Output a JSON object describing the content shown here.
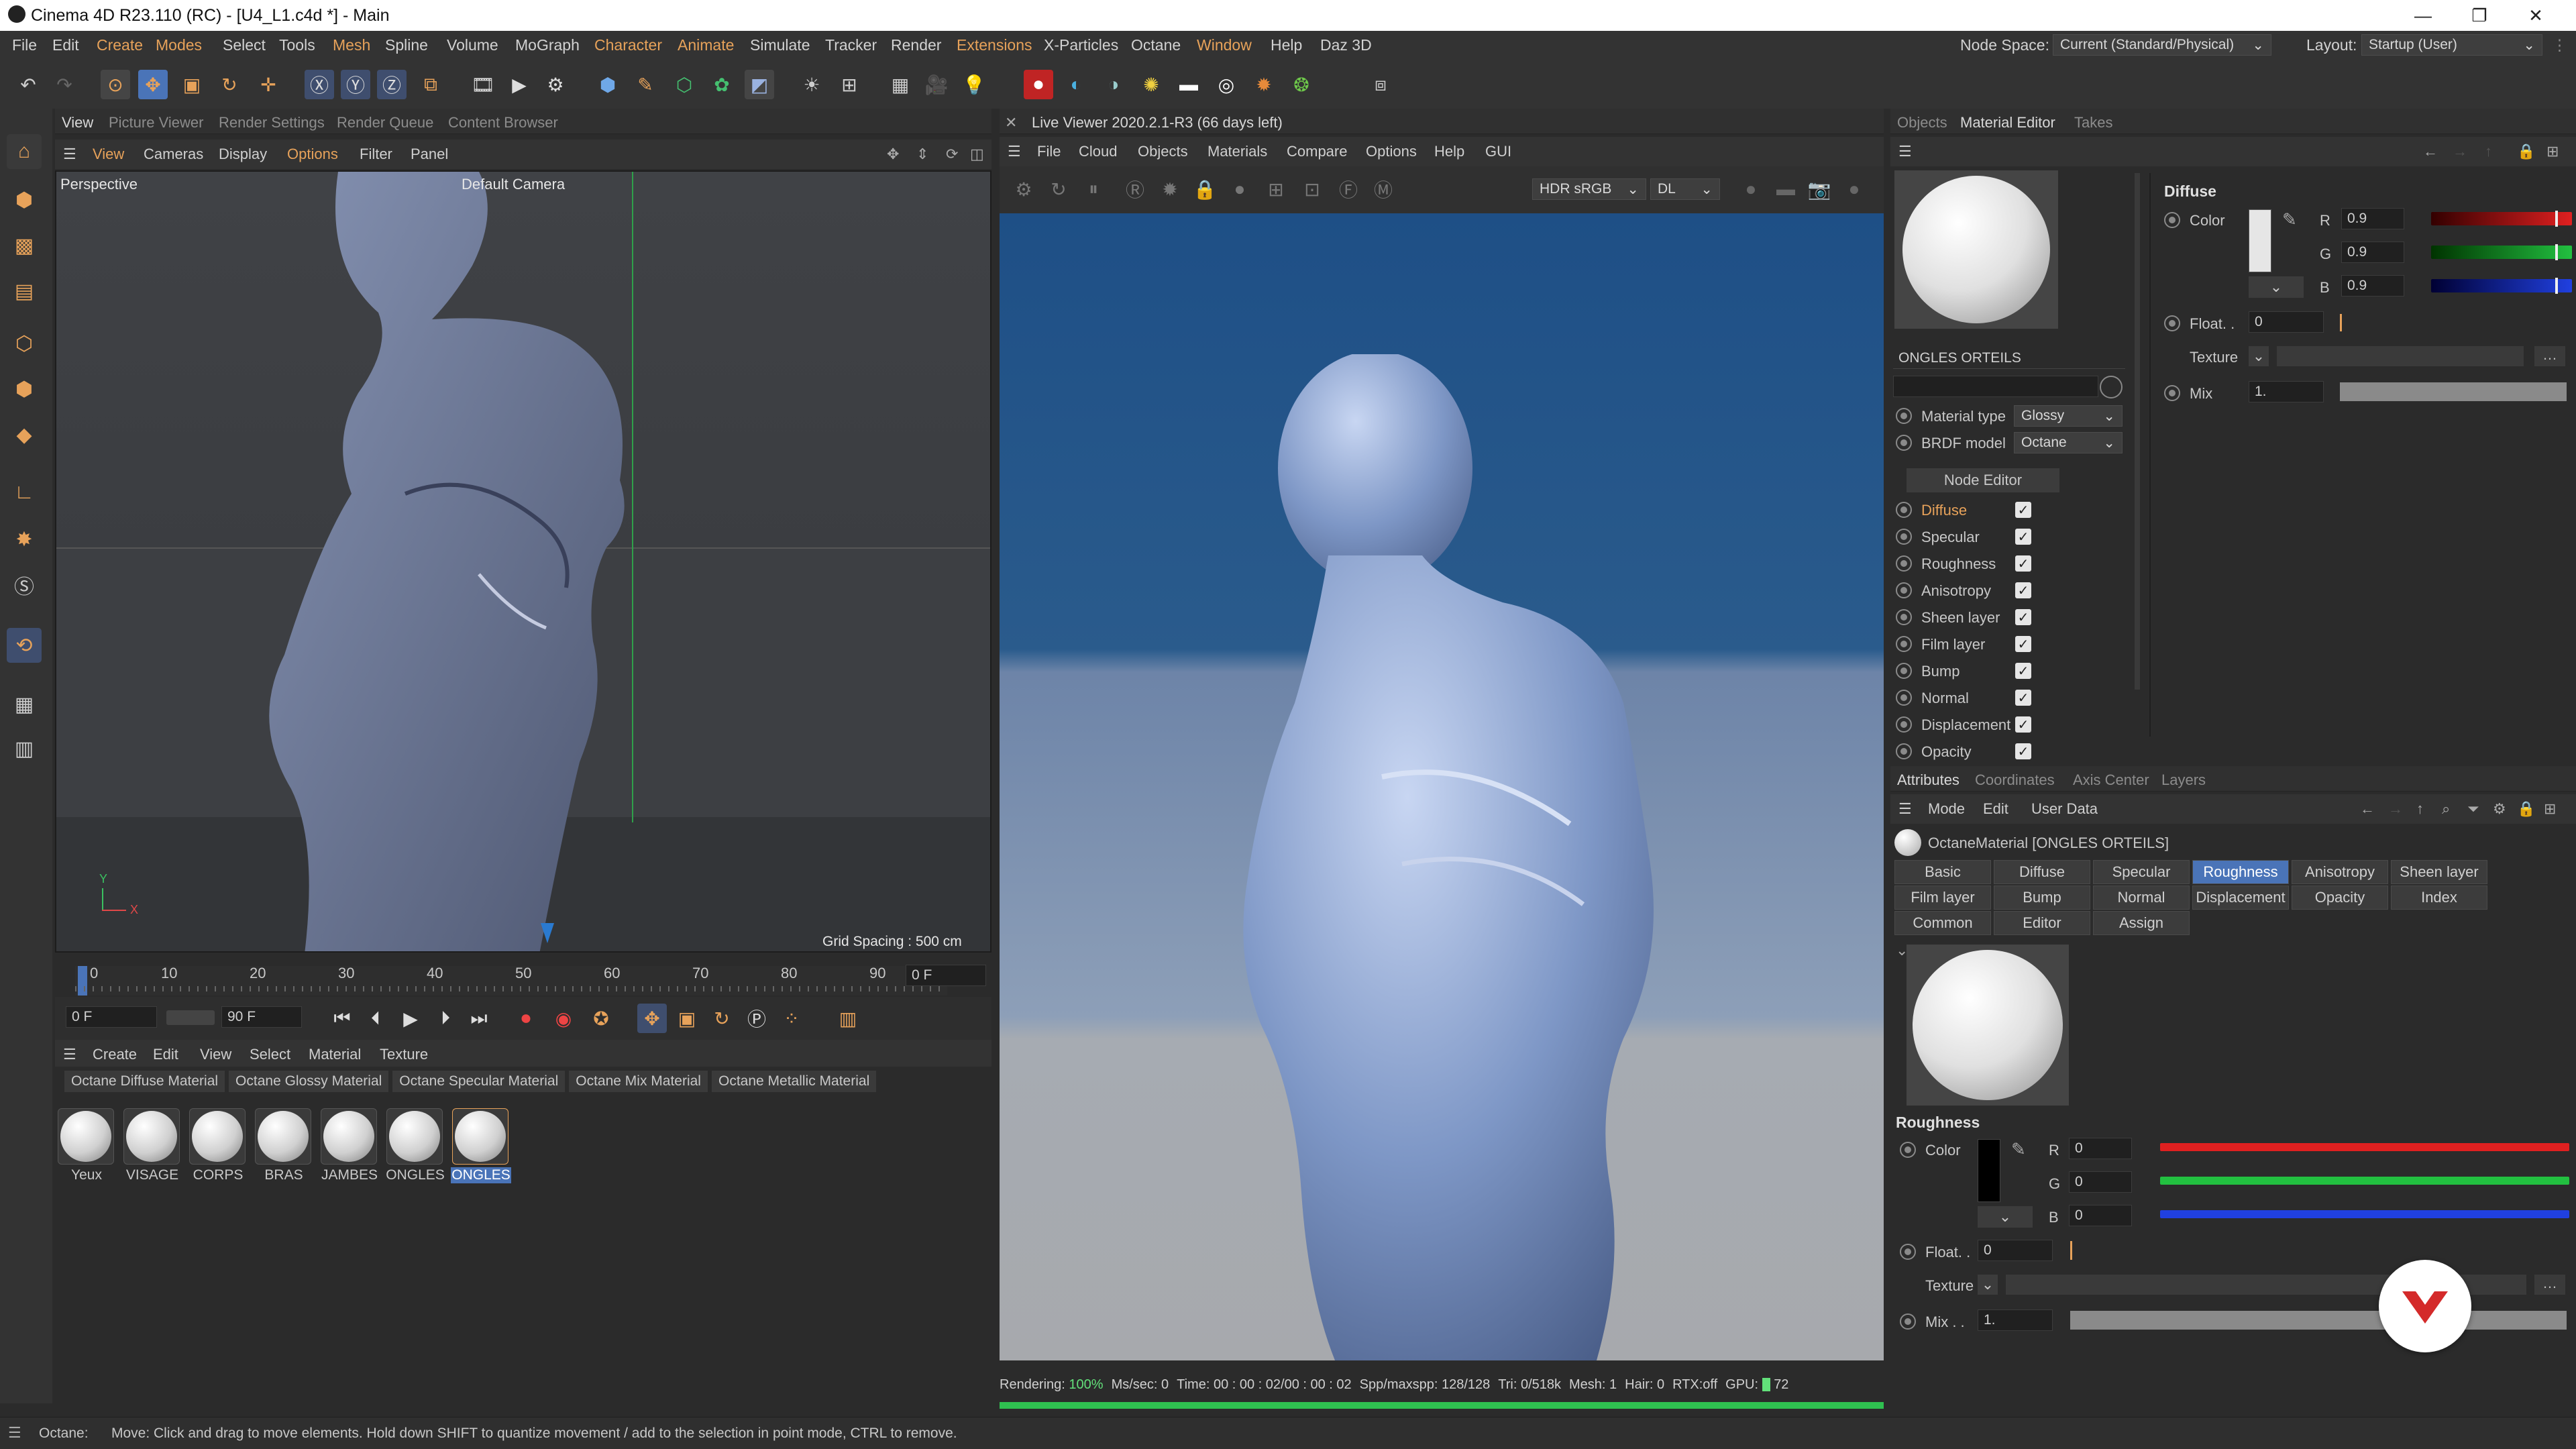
{
  "window": {
    "title": "Cinema 4D R23.110 (RC) - [U4_L1.c4d *] - Main"
  },
  "menubar": {
    "items": [
      "File",
      "Edit",
      "Create",
      "Modes",
      "Select",
      "Tools",
      "Mesh",
      "Spline",
      "Volume",
      "MoGraph",
      "Character",
      "Animate",
      "Simulate",
      "Tracker",
      "Render",
      "Extensions",
      "X-Particles",
      "Octane",
      "Window",
      "Help",
      "Daz 3D"
    ],
    "node_space_label": "Node Space:",
    "node_space_value": "Current (Standard/Physical)",
    "layout_label": "Layout:",
    "layout_value": "Startup (User)"
  },
  "viewport_panel": {
    "tabs": [
      "View",
      "Picture Viewer",
      "Render Settings",
      "Render Queue",
      "Content Browser"
    ],
    "menu": [
      "View",
      "Cameras",
      "Display",
      "Options",
      "Filter",
      "Panel"
    ],
    "label": "Perspective",
    "camera": "Default Camera",
    "grid_spacing": "Grid Spacing : 500 cm",
    "axis_y": "Y",
    "axis_x": "X"
  },
  "timeline": {
    "ticks": [
      "0",
      "10",
      "20",
      "30",
      "40",
      "50",
      "60",
      "70",
      "80",
      "90"
    ],
    "current_frame": "0 F",
    "start_field": "0 F",
    "end_field": "90 F"
  },
  "material_manager": {
    "menu": [
      "Create",
      "Edit",
      "View",
      "Select",
      "Material",
      "Texture"
    ],
    "presets": [
      "Octane Diffuse Material",
      "Octane Glossy Material",
      "Octane Specular Material",
      "Octane Mix Material",
      "Octane Metallic Material"
    ],
    "materials": [
      "Yeux",
      "VISAGE",
      "CORPS",
      "BRAS",
      "JAMBES",
      "ONGLES",
      "ONGLES"
    ]
  },
  "live_viewer": {
    "title": "Live Viewer 2020.2.1-R3 (66 days left)",
    "menu": [
      "File",
      "Cloud",
      "Objects",
      "Materials",
      "Compare",
      "Options",
      "Help",
      "GUI"
    ],
    "color_space": "HDR sRGB",
    "kernel": "DL",
    "status": {
      "rendering": "Rendering:",
      "rendering_pct": "100%",
      "mssec": "Ms/sec: 0",
      "time": "Time: 00 : 00 : 02/00 : 00 : 02",
      "spp": "Spp/maxspp: 128/128",
      "tri": "Tri: 0/518k",
      "mesh": "Mesh: 1",
      "hair": "Hair: 0",
      "rtx": "RTX:off",
      "gpu": "GPU:",
      "gpu_val": "72"
    },
    "progress": 1.0
  },
  "material_editor": {
    "tabs": [
      "Objects",
      "Material Editor",
      "Takes"
    ],
    "material_name": "ONGLES ORTEILS",
    "material_type_label": "Material type",
    "material_type": "Glossy",
    "brdf_label": "BRDF model",
    "brdf": "Octane",
    "node_editor": "Node Editor",
    "channels": [
      "Diffuse",
      "Specular",
      "Roughness",
      "Anisotropy",
      "Sheen layer",
      "Film layer",
      "Bump",
      "Normal",
      "Displacement",
      "Opacity"
    ],
    "diffuse": {
      "heading": "Diffuse",
      "color_label": "Color",
      "r_label": "R",
      "r": "0.9",
      "g_label": "G",
      "g": "0.9",
      "b_label": "B",
      "b": "0.9",
      "float_label": "Float. .",
      "float": "0",
      "texture_label": "Texture",
      "mix_label": "Mix",
      "mix": "1.",
      "color_hex": "#e6e6e6",
      "rgb_fraction": 0.9
    }
  },
  "attributes": {
    "tabs": [
      "Attributes",
      "Coordinates",
      "Axis Center",
      "Layers"
    ],
    "menu": [
      "Mode",
      "Edit",
      "User Data"
    ],
    "object_label": "OctaneMaterial [ONGLES ORTEILS]",
    "param_tabs": [
      "Basic",
      "Diffuse",
      "Specular",
      "Roughness",
      "Anisotropy",
      "Sheen layer",
      "Film layer",
      "Bump",
      "Normal",
      "Displacement",
      "Opacity",
      "Index",
      "Common",
      "Editor",
      "Assign"
    ],
    "active_tab": "Roughness",
    "roughness": {
      "heading": "Roughness",
      "color_label": "Color",
      "r_label": "R",
      "r": "0",
      "g_label": "G",
      "g": "0",
      "b_label": "B",
      "b": "0",
      "float_label": "Float. .",
      "float": "0",
      "texture_label": "Texture",
      "mix_label": "Mix . .",
      "mix": "1.",
      "color_hex": "#000000"
    }
  },
  "statusbar": {
    "label": "Octane:",
    "message": "Move: Click and drag to move elements. Hold down SHIFT to quantize movement / add to the selection in point mode, CTRL to remove."
  },
  "colors": {
    "accent_orange": "#e7a25a",
    "active_tab_blue": "#4a74b8",
    "brand_red": "#d42a2a"
  }
}
